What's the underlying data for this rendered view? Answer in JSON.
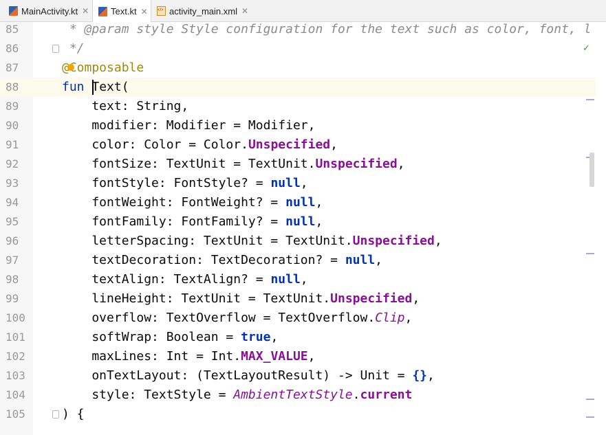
{
  "tabs": [
    {
      "label": "MainActivity.kt",
      "icon": "kotlin-file-icon",
      "active": false
    },
    {
      "label": "Text.kt",
      "icon": "kotlin-file-icon",
      "active": true
    },
    {
      "label": "activity_main.xml",
      "icon": "xml-file-icon",
      "active": false
    }
  ],
  "close_glyph": "✕",
  "editor": {
    "current_line": "88",
    "lines": [
      {
        "n": "85",
        "segs": [
          [
            "comment",
            " * @param style Style configuration for the text such as color, font, l"
          ]
        ]
      },
      {
        "n": "86",
        "segs": [
          [
            "comment",
            " */"
          ]
        ]
      },
      {
        "n": "87",
        "segs": [
          [
            "anno",
            "@Composable"
          ]
        ]
      },
      {
        "n": "88",
        "segs": [
          [
            "kwplain",
            "fun"
          ],
          [
            "plain",
            " Text("
          ]
        ]
      },
      {
        "n": "89",
        "segs": [
          [
            "plain",
            "    text: String,"
          ]
        ]
      },
      {
        "n": "90",
        "segs": [
          [
            "plain",
            "    modifier: Modifier = Modifier,"
          ]
        ]
      },
      {
        "n": "91",
        "segs": [
          [
            "plain",
            "    color: Color = Color."
          ],
          [
            "purple",
            "Unspecified"
          ],
          [
            "plain",
            ","
          ]
        ]
      },
      {
        "n": "92",
        "segs": [
          [
            "plain",
            "    fontSize: TextUnit = TextUnit."
          ],
          [
            "purple",
            "Unspecified"
          ],
          [
            "plain",
            ","
          ]
        ]
      },
      {
        "n": "93",
        "segs": [
          [
            "plain",
            "    fontStyle: FontStyle? = "
          ],
          [
            "kw",
            "null"
          ],
          [
            "plain",
            ","
          ]
        ]
      },
      {
        "n": "94",
        "segs": [
          [
            "plain",
            "    fontWeight: FontWeight? = "
          ],
          [
            "kw",
            "null"
          ],
          [
            "plain",
            ","
          ]
        ]
      },
      {
        "n": "95",
        "segs": [
          [
            "plain",
            "    fontFamily: FontFamily? = "
          ],
          [
            "kw",
            "null"
          ],
          [
            "plain",
            ","
          ]
        ]
      },
      {
        "n": "96",
        "segs": [
          [
            "plain",
            "    letterSpacing: TextUnit = TextUnit."
          ],
          [
            "purple",
            "Unspecified"
          ],
          [
            "plain",
            ","
          ]
        ]
      },
      {
        "n": "97",
        "segs": [
          [
            "plain",
            "    textDecoration: TextDecoration? = "
          ],
          [
            "kw",
            "null"
          ],
          [
            "plain",
            ","
          ]
        ]
      },
      {
        "n": "98",
        "segs": [
          [
            "plain",
            "    textAlign: TextAlign? = "
          ],
          [
            "kw",
            "null"
          ],
          [
            "plain",
            ","
          ]
        ]
      },
      {
        "n": "99",
        "segs": [
          [
            "plain",
            "    lineHeight: TextUnit = TextUnit."
          ],
          [
            "purple",
            "Unspecified"
          ],
          [
            "plain",
            ","
          ]
        ]
      },
      {
        "n": "100",
        "segs": [
          [
            "plain",
            "    overflow: TextOverflow = TextOverflow."
          ],
          [
            "italic-purple",
            "Clip"
          ],
          [
            "plain",
            ","
          ]
        ]
      },
      {
        "n": "101",
        "segs": [
          [
            "plain",
            "    softWrap: Boolean = "
          ],
          [
            "kw",
            "true"
          ],
          [
            "plain",
            ","
          ]
        ]
      },
      {
        "n": "102",
        "segs": [
          [
            "plain",
            "    maxLines: Int = Int."
          ],
          [
            "purple",
            "MAX_VALUE"
          ],
          [
            "plain",
            ","
          ]
        ]
      },
      {
        "n": "103",
        "segs": [
          [
            "plain",
            "    onTextLayout: (TextLayoutResult) -> Unit = "
          ],
          [
            "kw",
            "{}"
          ],
          [
            "plain",
            ","
          ]
        ]
      },
      {
        "n": "104",
        "segs": [
          [
            "plain",
            "    style: TextStyle = "
          ],
          [
            "italic-purple",
            "AmbientTextStyle"
          ],
          [
            "plain",
            "."
          ],
          [
            "purple",
            "current"
          ]
        ]
      },
      {
        "n": "105",
        "segs": [
          [
            "plain",
            ") {"
          ]
        ]
      }
    ]
  },
  "status": {
    "analysis_icon": "check-icon",
    "check_glyph": "✓"
  }
}
